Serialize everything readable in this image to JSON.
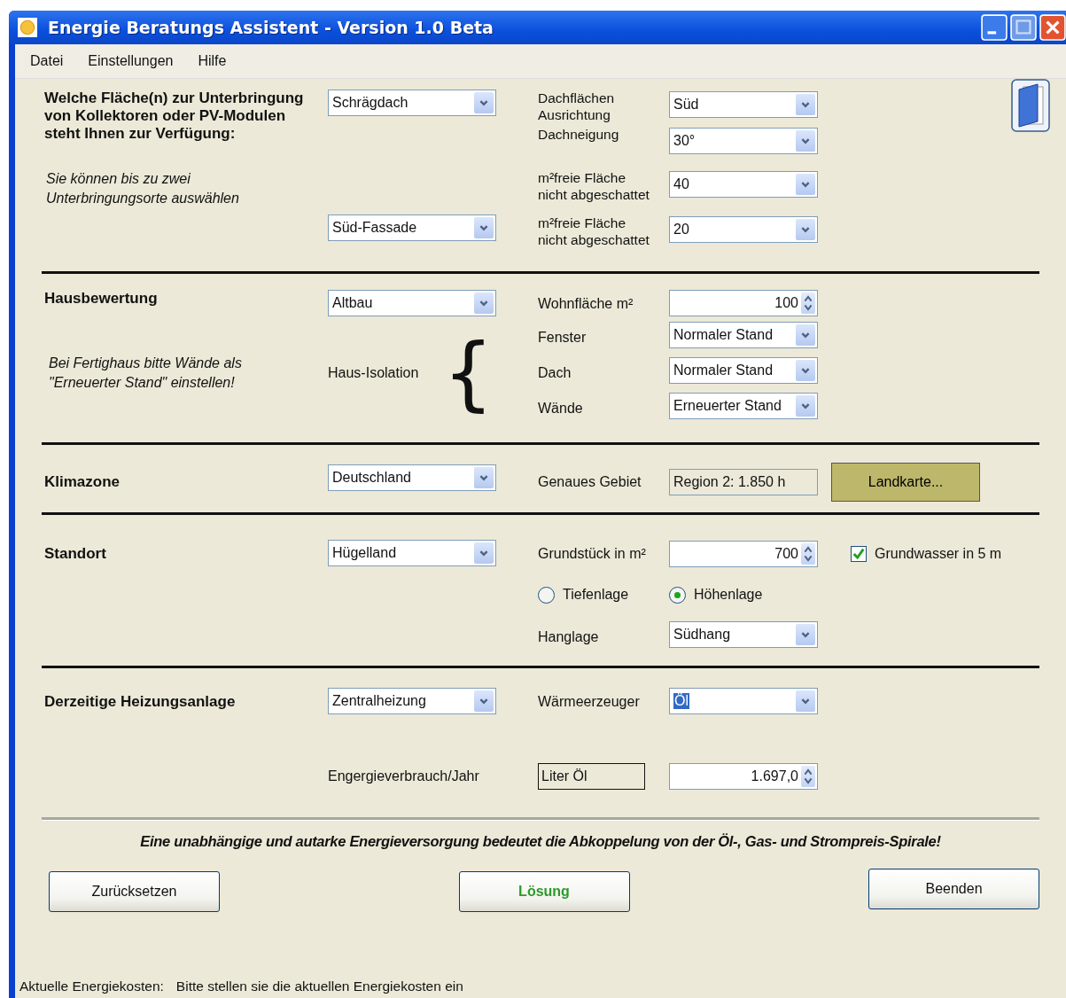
{
  "window": {
    "title": "Energie Beratungs Assistent - Version 1.0 Beta"
  },
  "menu": [
    "Datei",
    "Einstellungen",
    "Hilfe"
  ],
  "areas": {
    "question": "Welche Fläche(n) zur Unterbringung von Kollektoren oder PV-Modulen steht Ihnen zur Verfügung:",
    "hint": "Sie können bis zu zwei Unterbringungsorte auswählen",
    "place_1": "Schrägdach",
    "place_2": "Süd-Fassade",
    "fields": [
      {
        "label": "Dachflächen Ausrichtung",
        "value": "Süd"
      },
      {
        "label": "Dachneigung",
        "value": "30°"
      },
      {
        "label": "m²freie Fläche nicht abgeschattet",
        "value": "40"
      },
      {
        "label": "m²freie Fläche nicht abgeschattet",
        "value": "20"
      }
    ]
  },
  "house": {
    "title": "Hausbewertung",
    "type": "Altbau",
    "hint": "Bei Fertighaus bitte Wände als \"Erneuerter Stand\" einstellen!",
    "isolation_label": "Haus-Isolation",
    "brace": "{",
    "area_label": "Wohnfläche m²",
    "area_value": "100",
    "isolation": [
      {
        "label": "Fenster",
        "value": "Normaler Stand"
      },
      {
        "label": "Dach",
        "value": "Normaler Stand"
      },
      {
        "label": "Wände",
        "value": "Erneuerter Stand"
      }
    ]
  },
  "climate": {
    "title": "Klimazone",
    "zone": "Deutschland",
    "area_label": "Genaues Gebiet",
    "area_value": "Region 2:  1.850 h",
    "map_button": "Landkarte..."
  },
  "site": {
    "title": "Standort",
    "terrain": "Hügelland",
    "plot_label": "Grundstück in m²",
    "plot_value": "700",
    "groundwater": {
      "label": "Grundwasser in 5 m",
      "checked": true
    },
    "positions": [
      {
        "label": "Tiefenlage",
        "selected": false
      },
      {
        "label": "Höhenlage",
        "selected": true
      }
    ],
    "slope_label": "Hanglage",
    "slope_value": "Südhang"
  },
  "heating": {
    "title": "Derzeitige Heizungsanlage",
    "system": "Zentralheizung",
    "generator_label": "Wärmeerzeuger",
    "generator_value": "Öl",
    "generator_value_selected": true,
    "consumption_label": "Engergieverbrauch/Jahr",
    "unit": "Liter Öl",
    "consumption_value": "1.697,0"
  },
  "slogan": "Eine unabhängige und autarke Energieversorgung bedeutet die Abkoppelung von der Öl-, Gas- und Strompreis-Spirale!",
  "buttons": [
    {
      "label": "Zurücksetzen",
      "kind": "normal"
    },
    {
      "label": "Lösung",
      "kind": "primary"
    },
    {
      "label": "Beenden",
      "kind": "normal"
    }
  ],
  "status_bar": {
    "label": "Aktuelle Energiekosten:",
    "message": "Bitte stellen sie die aktuellen Energiekosten ein"
  }
}
